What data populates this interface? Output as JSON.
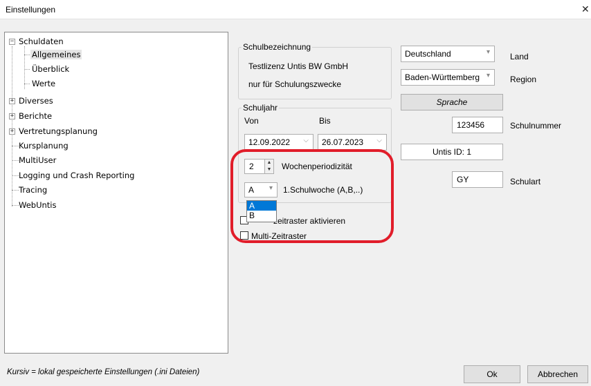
{
  "window": {
    "title": "Einstellungen",
    "close_glyph": "✕"
  },
  "tree": {
    "items": [
      {
        "label": "Schuldaten",
        "expander": "−"
      },
      {
        "label": "Allgemeines"
      },
      {
        "label": "Überblick"
      },
      {
        "label": "Werte"
      },
      {
        "label": "Diverses",
        "expander": "+"
      },
      {
        "label": "Berichte",
        "expander": "+"
      },
      {
        "label": "Vertretungsplanung",
        "expander": "+"
      },
      {
        "label": "Kursplanung"
      },
      {
        "label": "MultiUser"
      },
      {
        "label": "Logging und Crash Reporting"
      },
      {
        "label": "Tracing"
      },
      {
        "label": "WebUntis"
      }
    ]
  },
  "schulbezeichnung": {
    "legend": "Schulbezeichnung",
    "line1": "Testlizenz Untis BW GmbH",
    "line2": "nur für Schulungszwecke"
  },
  "land": {
    "value": "Deutschland",
    "label": "Land"
  },
  "region": {
    "value": "Baden-Württemberg",
    "label": "Region"
  },
  "sprache_button": "Sprache",
  "schulnummer": {
    "value": "123456",
    "label": "Schulnummer"
  },
  "untis_id": "Untis ID: 1",
  "schulart": {
    "value": "GY",
    "label": "Schulart"
  },
  "schuljahr": {
    "legend": "Schuljahr",
    "von_label": "Von",
    "bis_label": "Bis",
    "von": "12.09.2022",
    "bis": "26.07.2023"
  },
  "wochen": {
    "value": "2",
    "label": "Wochenperiodizität",
    "schulwoche_value": "A",
    "schulwoche_label": "1.Schulwoche (A,B,..)",
    "options": [
      "A",
      "B"
    ]
  },
  "checkboxes": {
    "zeitraster_partial": "zeitraster aktivieren",
    "multi_zeitraster": "Multi-Zeitraster"
  },
  "footer": {
    "status": "Kursiv = lokal gespeicherte Einstellungen (.ini Dateien)",
    "ok": "Ok",
    "cancel": "Abbrechen"
  },
  "colors": {
    "highlight": "#e11d2a",
    "selection": "#0078d7"
  },
  "icons": {
    "spin_up": "▲",
    "spin_down": "▼",
    "combo_arrow": "▾",
    "date_arrow": "⌵"
  }
}
